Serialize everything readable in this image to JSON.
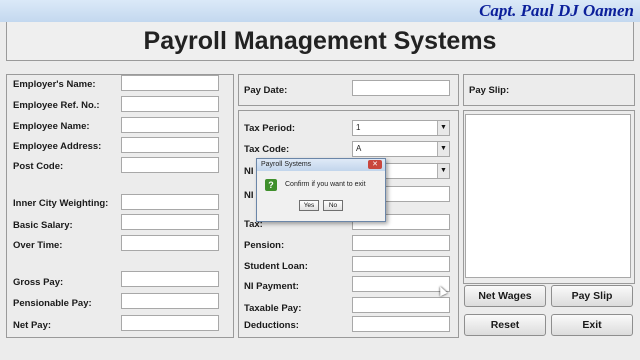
{
  "watermark": "Capt. Paul DJ Oamen",
  "header": {
    "title": "Payroll Management Systems"
  },
  "employee": {
    "employer_name": "Employer's Name:",
    "employee_ref": "Employee Ref. No.:",
    "employee_name": "Employee Name:",
    "employee_address": "Employee Address:",
    "post_code": "Post Code:",
    "inner_city": "Inner City Weighting:",
    "basic_salary": "Basic Salary:",
    "over_time": "Over Time:",
    "gross_pay": "Gross Pay:",
    "pensionable_pay": "Pensionable Pay:",
    "net_pay": "Net Pay:"
  },
  "tax": {
    "pay_date": "Pay Date:",
    "tax_period": "Tax Period:",
    "tax_period_value": "1",
    "tax_code": "Tax Code:",
    "tax_code_value": "A",
    "ni_code": "NI",
    "ni_number": "NI",
    "tax": "Tax:",
    "pension": "Pension:",
    "student_loan": "Student Loan:",
    "ni_payment": "NI Payment:",
    "taxable_pay": "Taxable Pay:",
    "deductions": "Deductions:"
  },
  "payslip": {
    "label": "Pay Slip:"
  },
  "buttons": {
    "net_wages": "Net Wages",
    "pay_slip": "Pay Slip",
    "reset": "Reset",
    "exit": "Exit"
  },
  "dialog": {
    "title": "Payroll Systems",
    "icon": "question-icon",
    "message": "Confirm if you want to exit",
    "yes": "Yes",
    "no": "No"
  }
}
